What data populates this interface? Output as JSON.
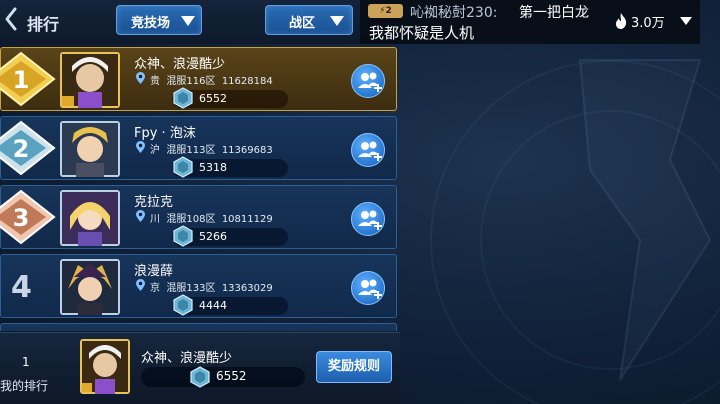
{
  "header": {
    "title": "排行",
    "mode_dropdown": "竞技场",
    "region_dropdown": "战区"
  },
  "stream": {
    "level_badge": "2",
    "username": "吣袽秘尌230:",
    "message_line1": "第一把白龙",
    "message_line2": "我都怀疑是人机",
    "popularity": "3.0万"
  },
  "rows": [
    {
      "rank": "1",
      "name": "众神、浪漫酷少",
      "loc": "贵",
      "server": "混服116区",
      "id": "11628184",
      "score": "6552"
    },
    {
      "rank": "2",
      "name": "Fpy · 泡沫",
      "loc": "沪",
      "server": "混服113区",
      "id": "11369683",
      "score": "5318"
    },
    {
      "rank": "3",
      "name": "克拉克",
      "loc": "川",
      "server": "混服108区",
      "id": "10811129",
      "score": "5266"
    },
    {
      "rank": "4",
      "name": "浪漫薛",
      "loc": "京",
      "server": "混服133区",
      "id": "13363029",
      "score": "4444"
    }
  ],
  "footer": {
    "my_rank": "1",
    "my_rank_label": "我的排行",
    "my_name": "众神、浪漫酷少",
    "my_score": "6552",
    "reward_button": "奖励规则"
  },
  "colors": {
    "gold_row": "#5a4418",
    "blue_row": "#17345a",
    "accent": "#2f7fd8"
  }
}
